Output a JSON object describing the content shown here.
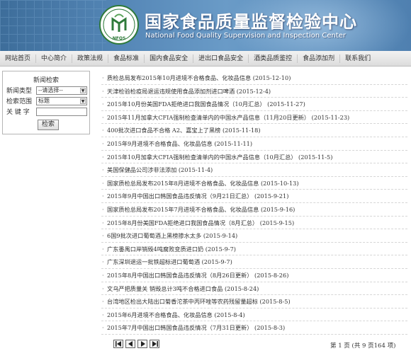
{
  "header": {
    "title_cn": "国家食品质量监督检验中心",
    "title_en": "National Food Quality Supervision and Inspection Center",
    "logo_text": "NFQS"
  },
  "nav": [
    "网站首页",
    "中心简介",
    "政策法规",
    "食品标准",
    "国内食品安全",
    "进出口食品安全",
    "酒类品质鉴控",
    "食品添加剂",
    "联系我们"
  ],
  "search": {
    "title": "新闻检索",
    "type_label": "新闻类型",
    "type_value": "--请选择--",
    "scope_label": "检索范围",
    "scope_value": "标题",
    "keyword_label": "关 键 字",
    "keyword_value": "",
    "button": "检索"
  },
  "news": [
    "质检总局发布2015年10月进境不合格食品、化妆品信息 (2015-12-10)",
    "天津检验检疫局退运违规使用食品添加剂进口啤酒 (2015-12-4)",
    "2015年10月份美国FDA拒绝进口我国食品情况（10月汇总） (2015-11-27)",
    "2015年11月加拿大CFIA强制检查清单内的中国水产品信息（11月20日更新） (2015-11-23)",
    "400批次进口食品不合格 A2、嘉宝上了黑榜 (2015-11-18)",
    "2015年9月进境不合格食品、化妆品信息 (2015-11-11)",
    "2015年10月加拿大CFIA强制检查清单内的中国水产品信息（10月汇总） (2015-11-5)",
    "美国保健品公司涉非法添加 (2015-11-4)",
    "国家质检总局发布2015年8月进境不合格食品、化妆品信息 (2015-10-13)",
    "2015年9月中国出口韩国食品违反情况（9月21日汇总） (2015-9-21)",
    "国家质检总局发布2015年7月进境不合格食品、化妆品信息 (2015-9-16)",
    "2015年8月份美国FDA拒绝进口我国食品情况（8月汇总） (2015-9-15)",
    "6国9批次进口葡萄酒上黑榜掺水太多 (2015-9-14)",
    "广东番禺口岸销毁4吨腐败变质进口奶 (2015-9-7)",
    "广东深圳退运一批铁超标进口葡萄酒 (2015-9-7)",
    "2015年8月中国出口韩国食品违反情况（8月26日更新） (2015-8-26)",
    "文乌严把质量关 销毁总计3吨不合格进口食品 (2015-8-24)",
    "台湾地区检出大陆出口菊香沱茶中丙环唑等农药残留量超标 (2015-8-5)",
    "2015年6月进境不合格食品、化妆品信息 (2015-8-4)",
    "2015年7月中国出口韩国食品违反情况（7月31日更新） (2015-8-3)"
  ],
  "pagination": {
    "info": "第 1 页 (共 9 页164 项)",
    "buttons": [
      "first-page-icon",
      "prev-page-icon",
      "next-page-icon",
      "last-page-icon"
    ]
  }
}
